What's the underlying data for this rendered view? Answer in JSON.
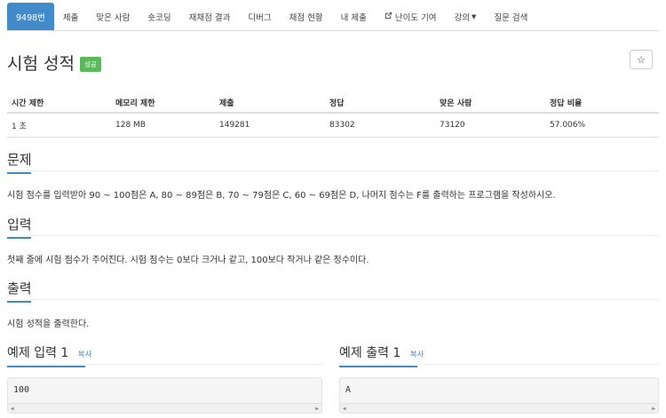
{
  "tabs": [
    {
      "label": "9498번",
      "active": true
    },
    {
      "label": "제출"
    },
    {
      "label": "맞은 사람"
    },
    {
      "label": "숏코딩"
    },
    {
      "label": "재채점 결과"
    },
    {
      "label": "디버그"
    },
    {
      "label": "채점 현황"
    },
    {
      "label": "내 제출"
    },
    {
      "label": "난이도 기여",
      "icon": "external-link-icon"
    },
    {
      "label": "강의",
      "icon": "caret-down-icon"
    },
    {
      "label": "질문 검색"
    }
  ],
  "title": "시험 성적",
  "badge": "성공",
  "star": "☆",
  "table": {
    "headers": [
      "시간 제한",
      "메모리 제한",
      "제출",
      "정답",
      "맞은 사람",
      "정답 비율"
    ],
    "values": [
      "1 초",
      "128 MB",
      "149281",
      "83302",
      "73120",
      "57.006%"
    ]
  },
  "sections": {
    "problem": {
      "heading": "문제",
      "text": "시험 점수를 입력받아 90 ~ 100점은 A, 80 ~ 89점은 B, 70 ~ 79점은 C, 60 ~ 69점은 D, 나머지 점수는 F를 출력하는 프로그램을 작성하시오."
    },
    "input": {
      "heading": "입력",
      "text": "첫째 줄에 시험 점수가 주어진다. 시험 점수는 0보다 크거나 같고, 100보다 작거나 같은 정수이다."
    },
    "output": {
      "heading": "출력",
      "text": "시험 성적을 출력한다."
    }
  },
  "examples": {
    "input": {
      "heading": "예제 입력 1",
      "copy": "복사",
      "code": "100"
    },
    "output": {
      "heading": "예제 출력 1",
      "copy": "복사",
      "code": "A"
    }
  }
}
